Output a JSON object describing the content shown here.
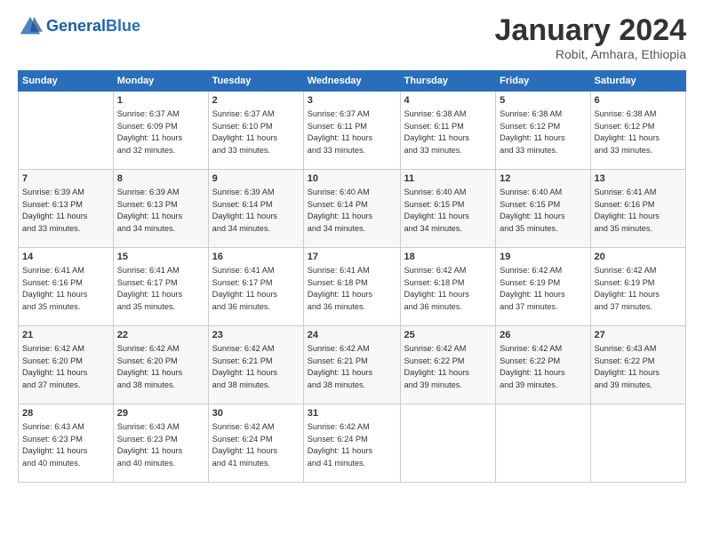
{
  "header": {
    "logo_general": "General",
    "logo_blue": "Blue",
    "main_title": "January 2024",
    "subtitle": "Robit, Amhara, Ethiopia"
  },
  "days_of_week": [
    "Sunday",
    "Monday",
    "Tuesday",
    "Wednesday",
    "Thursday",
    "Friday",
    "Saturday"
  ],
  "weeks": [
    [
      {
        "day": "",
        "info": ""
      },
      {
        "day": "1",
        "info": "Sunrise: 6:37 AM\nSunset: 6:09 PM\nDaylight: 11 hours\nand 32 minutes."
      },
      {
        "day": "2",
        "info": "Sunrise: 6:37 AM\nSunset: 6:10 PM\nDaylight: 11 hours\nand 33 minutes."
      },
      {
        "day": "3",
        "info": "Sunrise: 6:37 AM\nSunset: 6:11 PM\nDaylight: 11 hours\nand 33 minutes."
      },
      {
        "day": "4",
        "info": "Sunrise: 6:38 AM\nSunset: 6:11 PM\nDaylight: 11 hours\nand 33 minutes."
      },
      {
        "day": "5",
        "info": "Sunrise: 6:38 AM\nSunset: 6:12 PM\nDaylight: 11 hours\nand 33 minutes."
      },
      {
        "day": "6",
        "info": "Sunrise: 6:38 AM\nSunset: 6:12 PM\nDaylight: 11 hours\nand 33 minutes."
      }
    ],
    [
      {
        "day": "7",
        "info": "Sunrise: 6:39 AM\nSunset: 6:13 PM\nDaylight: 11 hours\nand 33 minutes."
      },
      {
        "day": "8",
        "info": "Sunrise: 6:39 AM\nSunset: 6:13 PM\nDaylight: 11 hours\nand 34 minutes."
      },
      {
        "day": "9",
        "info": "Sunrise: 6:39 AM\nSunset: 6:14 PM\nDaylight: 11 hours\nand 34 minutes."
      },
      {
        "day": "10",
        "info": "Sunrise: 6:40 AM\nSunset: 6:14 PM\nDaylight: 11 hours\nand 34 minutes."
      },
      {
        "day": "11",
        "info": "Sunrise: 6:40 AM\nSunset: 6:15 PM\nDaylight: 11 hours\nand 34 minutes."
      },
      {
        "day": "12",
        "info": "Sunrise: 6:40 AM\nSunset: 6:15 PM\nDaylight: 11 hours\nand 35 minutes."
      },
      {
        "day": "13",
        "info": "Sunrise: 6:41 AM\nSunset: 6:16 PM\nDaylight: 11 hours\nand 35 minutes."
      }
    ],
    [
      {
        "day": "14",
        "info": "Sunrise: 6:41 AM\nSunset: 6:16 PM\nDaylight: 11 hours\nand 35 minutes."
      },
      {
        "day": "15",
        "info": "Sunrise: 6:41 AM\nSunset: 6:17 PM\nDaylight: 11 hours\nand 35 minutes."
      },
      {
        "day": "16",
        "info": "Sunrise: 6:41 AM\nSunset: 6:17 PM\nDaylight: 11 hours\nand 36 minutes."
      },
      {
        "day": "17",
        "info": "Sunrise: 6:41 AM\nSunset: 6:18 PM\nDaylight: 11 hours\nand 36 minutes."
      },
      {
        "day": "18",
        "info": "Sunrise: 6:42 AM\nSunset: 6:18 PM\nDaylight: 11 hours\nand 36 minutes."
      },
      {
        "day": "19",
        "info": "Sunrise: 6:42 AM\nSunset: 6:19 PM\nDaylight: 11 hours\nand 37 minutes."
      },
      {
        "day": "20",
        "info": "Sunrise: 6:42 AM\nSunset: 6:19 PM\nDaylight: 11 hours\nand 37 minutes."
      }
    ],
    [
      {
        "day": "21",
        "info": "Sunrise: 6:42 AM\nSunset: 6:20 PM\nDaylight: 11 hours\nand 37 minutes."
      },
      {
        "day": "22",
        "info": "Sunrise: 6:42 AM\nSunset: 6:20 PM\nDaylight: 11 hours\nand 38 minutes."
      },
      {
        "day": "23",
        "info": "Sunrise: 6:42 AM\nSunset: 6:21 PM\nDaylight: 11 hours\nand 38 minutes."
      },
      {
        "day": "24",
        "info": "Sunrise: 6:42 AM\nSunset: 6:21 PM\nDaylight: 11 hours\nand 38 minutes."
      },
      {
        "day": "25",
        "info": "Sunrise: 6:42 AM\nSunset: 6:22 PM\nDaylight: 11 hours\nand 39 minutes."
      },
      {
        "day": "26",
        "info": "Sunrise: 6:42 AM\nSunset: 6:22 PM\nDaylight: 11 hours\nand 39 minutes."
      },
      {
        "day": "27",
        "info": "Sunrise: 6:43 AM\nSunset: 6:22 PM\nDaylight: 11 hours\nand 39 minutes."
      }
    ],
    [
      {
        "day": "28",
        "info": "Sunrise: 6:43 AM\nSunset: 6:23 PM\nDaylight: 11 hours\nand 40 minutes."
      },
      {
        "day": "29",
        "info": "Sunrise: 6:43 AM\nSunset: 6:23 PM\nDaylight: 11 hours\nand 40 minutes."
      },
      {
        "day": "30",
        "info": "Sunrise: 6:42 AM\nSunset: 6:24 PM\nDaylight: 11 hours\nand 41 minutes."
      },
      {
        "day": "31",
        "info": "Sunrise: 6:42 AM\nSunset: 6:24 PM\nDaylight: 11 hours\nand 41 minutes."
      },
      {
        "day": "",
        "info": ""
      },
      {
        "day": "",
        "info": ""
      },
      {
        "day": "",
        "info": ""
      }
    ]
  ]
}
